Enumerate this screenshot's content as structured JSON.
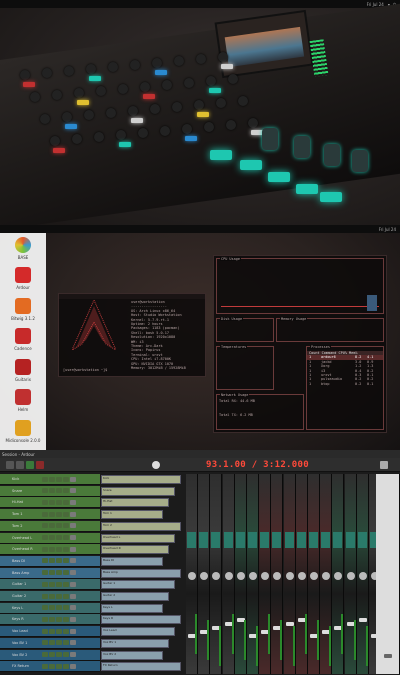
{
  "desktop1": {
    "topbar_title": "",
    "clock": "Fri Jul 24",
    "indicators": [
      "▾",
      "⏻"
    ]
  },
  "desktop2": {
    "dock": [
      {
        "label": "BASE",
        "icon": "circle-logo-icon",
        "color": "#e45a2b"
      },
      {
        "label": "Ardour",
        "icon": "ardour-icon",
        "color": "#d42a2a"
      },
      {
        "label": "Bitwig 3.1.2",
        "icon": "bitwig-icon",
        "color": "#e36b22"
      },
      {
        "label": "Cadence",
        "icon": "cadence-icon",
        "color": "#c72a2a"
      },
      {
        "label": "Guitarix",
        "icon": "guitar-icon",
        "color": "#b52222"
      },
      {
        "label": "Helm",
        "icon": "helm-icon",
        "color": "#c03030"
      },
      {
        "label": "Midiconsole 2.0.0",
        "icon": "speaker-icon",
        "color": "#e0a020"
      }
    ],
    "neofetch": {
      "prompt": "[user@workstation ~]$",
      "lines": [
        "user@workstation",
        "-----------------",
        "OS: Arch Linux x86_64",
        "Host: Studio Workstation",
        "Kernel: 5.7.9-rt-1",
        "Uptime: 2 hours",
        "Packages: 1183 (pacman)",
        "Shell: bash 5.0.17",
        "Resolution: 1920x1080",
        "WM: i3",
        "Theme: Arc-Dark",
        "Icons: Papirus",
        "Terminal: urxvt",
        "CPU: Intel i7-8700K",
        "GPU: NVIDIA GTX 1070",
        "Memory: 3012MiB / 15928MiB"
      ]
    },
    "btop": {
      "cpu_title": "CPU Usage",
      "mem_title": "Memory Usage",
      "net_title": "Network Usage",
      "proc_title": "Processes",
      "disk_title": "Disk Usage",
      "temps_title": "Temperatures",
      "proc_cols": [
        "Count",
        "Command",
        "CPU%",
        "Mem%"
      ],
      "proc_rows": [
        [
          "1",
          "ardour6",
          "8.2",
          "4.1"
        ],
        [
          "1",
          "jackd",
          "3.0",
          "0.9"
        ],
        [
          "1",
          "Xorg",
          "1.2",
          "1.3"
        ],
        [
          "1",
          "i3",
          "0.4",
          "0.2"
        ],
        [
          "1",
          "urxvt",
          "0.3",
          "0.1"
        ],
        [
          "1",
          "pulseaudio",
          "0.2",
          "0.2"
        ],
        [
          "1",
          "btop",
          "0.2",
          "0.1"
        ]
      ],
      "net_rx": "Total RX: 44.6 MB",
      "net_tx": "Total TX: 6.2 MB"
    }
  },
  "daw": {
    "window_title": "Session - Ardour",
    "clock": "93.1.00 / 3:12.000",
    "tracks": [
      {
        "name": "Kick",
        "color": "#4a7a3a"
      },
      {
        "name": "Snare",
        "color": "#4a7a3a"
      },
      {
        "name": "Hi-Hat",
        "color": "#4a7a3a"
      },
      {
        "name": "Tom 1",
        "color": "#4a7a3a"
      },
      {
        "name": "Tom 2",
        "color": "#4a7a3a"
      },
      {
        "name": "Overhead L",
        "color": "#4a7a3a"
      },
      {
        "name": "Overhead R",
        "color": "#4a7a3a"
      },
      {
        "name": "Bass DI",
        "color": "#3a6a8a"
      },
      {
        "name": "Bass Amp",
        "color": "#3a6a8a"
      },
      {
        "name": "Guitar 1",
        "color": "#3a6a6a"
      },
      {
        "name": "Guitar 2",
        "color": "#3a6a6a"
      },
      {
        "name": "Keys L",
        "color": "#3a6a6a"
      },
      {
        "name": "Keys R",
        "color": "#3a6a6a"
      },
      {
        "name": "Vox Lead",
        "color": "#2a5a7a"
      },
      {
        "name": "Vox BV 1",
        "color": "#2a5a7a"
      },
      {
        "name": "Vox BV 2",
        "color": "#2a5a7a"
      },
      {
        "name": "FX Return",
        "color": "#2a5a7a"
      }
    ]
  }
}
